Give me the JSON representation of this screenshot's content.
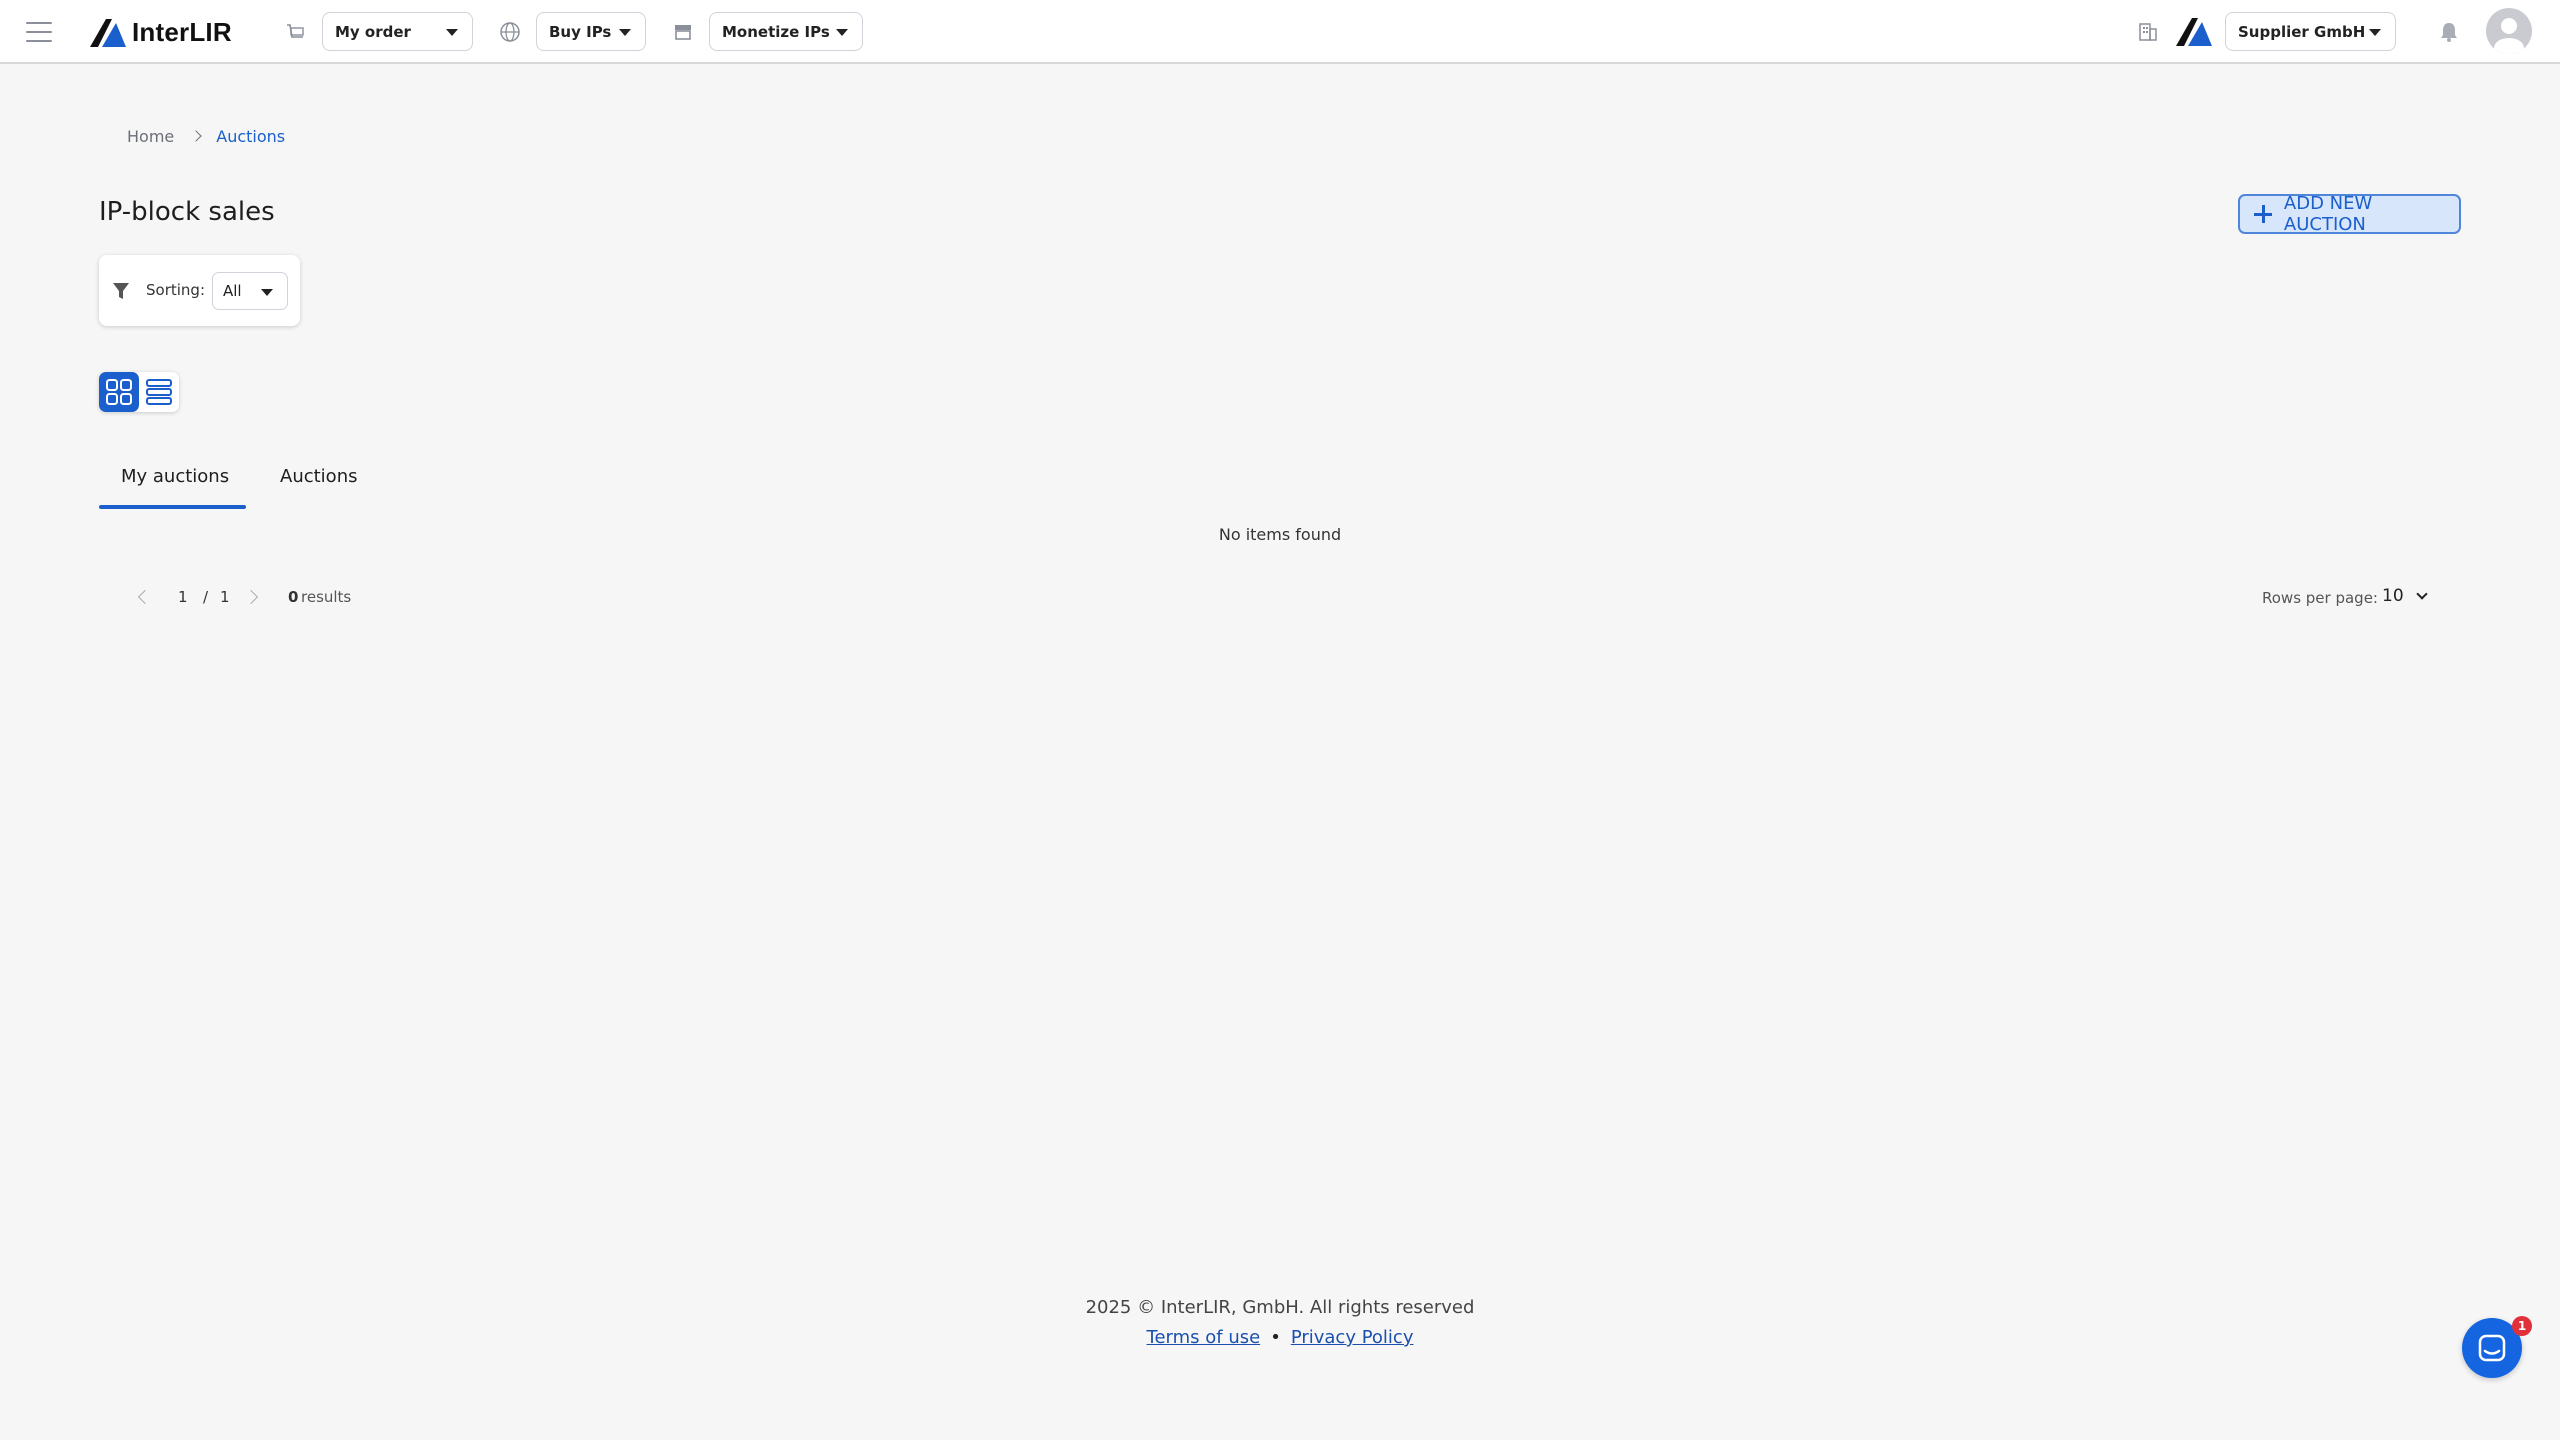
{
  "header": {
    "brand": "InterLIR",
    "order_select": "My order",
    "buy_select": "Buy IPs",
    "monetize_select": "Monetize IPs",
    "company_select": "Supplier GmbH",
    "icons": [
      "menu-icon",
      "cart-icon",
      "globe-icon",
      "store-icon",
      "building-icon",
      "bell-icon",
      "avatar"
    ]
  },
  "breadcrumb": {
    "home": "Home",
    "current": "Auctions"
  },
  "page": {
    "title": "IP-block sales",
    "add_button": "ADD NEW AUCTION"
  },
  "filter": {
    "label": "Sorting:",
    "value": "All"
  },
  "tabs": [
    {
      "label": "My auctions",
      "active": true
    },
    {
      "label": "Auctions",
      "active": false
    }
  ],
  "empty_message": "No items found",
  "pagination": {
    "current": "1",
    "separator": "/",
    "total": "1",
    "results_count": "0",
    "results_label": "results",
    "rows_label": "Rows per page:",
    "rows_value": "10"
  },
  "footer": {
    "copyright": "2025 © InterLIR, GmbH. All rights reserved",
    "terms": "Terms of use",
    "privacy": "Privacy Policy"
  },
  "chat": {
    "badge": "1"
  },
  "colors": {
    "accent": "#1a5fcc",
    "background": "#f6f6f6",
    "badge": "#e0313b"
  }
}
